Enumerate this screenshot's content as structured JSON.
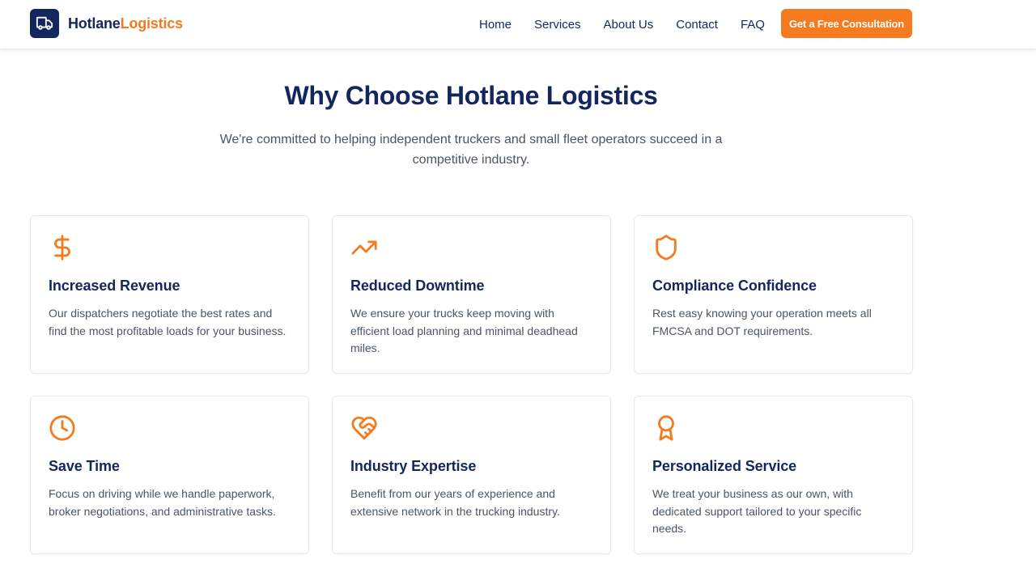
{
  "header": {
    "brand_part1": "Hotlane",
    "brand_part2": "Logistics",
    "logo_icon": "truck-icon",
    "nav": [
      {
        "label": "Home"
      },
      {
        "label": "Services"
      },
      {
        "label": "About Us"
      },
      {
        "label": "Contact"
      },
      {
        "label": "FAQ"
      }
    ],
    "cta_label": "Get a Free Consultation"
  },
  "section": {
    "title": "Why Choose Hotlane Logistics",
    "subtitle": "We're committed to helping independent truckers and small fleet operators succeed in a competitive industry."
  },
  "features": [
    {
      "icon": "dollar-icon",
      "title": "Increased Revenue",
      "description": "Our dispatchers negotiate the best rates and find the most profitable loads for your business."
    },
    {
      "icon": "trending-up-icon",
      "title": "Reduced Downtime",
      "description": "We ensure your trucks keep moving with efficient load planning and minimal deadhead miles."
    },
    {
      "icon": "shield-icon",
      "title": "Compliance Confidence",
      "description": "Rest easy knowing your operation meets all FMCSA and DOT requirements."
    },
    {
      "icon": "clock-icon",
      "title": "Save Time",
      "description": "Focus on driving while we handle paperwork, broker negotiations, and administrative tasks."
    },
    {
      "icon": "heart-handshake-icon",
      "title": "Industry Expertise",
      "description": "Benefit from our years of experience and extensive network in the trucking industry."
    },
    {
      "icon": "award-icon",
      "title": "Personalized Service",
      "description": "We treat your business as our own, with dedicated support tailored to your specific needs."
    }
  ],
  "colors": {
    "navy": "#13275e",
    "accent_orange": "#f47b20",
    "body_text": "#4a5566",
    "card_border": "#e6e9ee"
  }
}
